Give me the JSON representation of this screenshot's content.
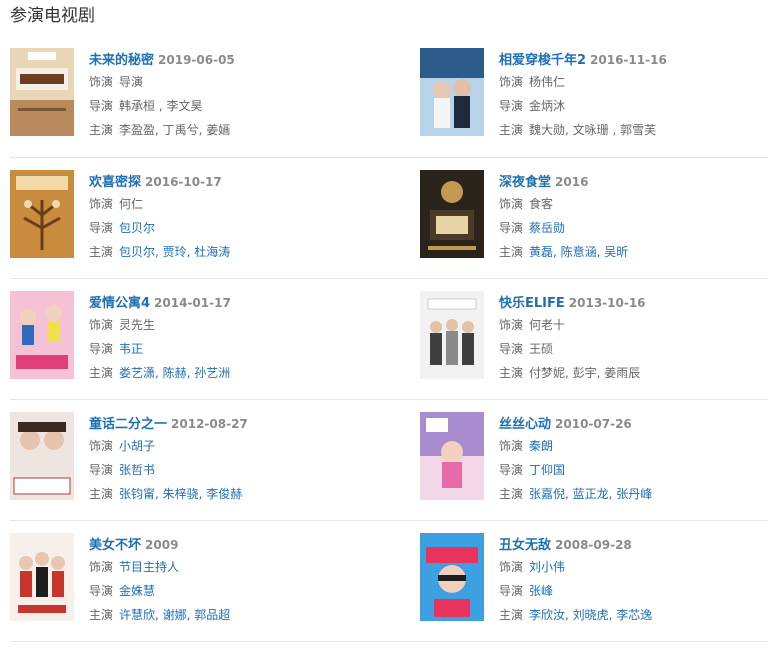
{
  "section_title": "参演电视剧",
  "labels": {
    "role": "饰演",
    "director": "导演",
    "cast": "主演"
  },
  "rows": [
    {
      "left": {
        "title": "未来的秘密",
        "date": "2019-06-05",
        "role": "导演",
        "role_link": false,
        "director": "韩承桓 , 李文昊",
        "director_link": false,
        "cast": "李盈盈, 丁禹兮, 姜婳",
        "cast_link": false,
        "poster_colors": [
          "#e9d6b7",
          "#a0714a"
        ]
      },
      "right": {
        "title": "相爱穿梭千年2",
        "date": "2016-11-16",
        "role": "杨伟仁",
        "role_link": false,
        "director": "金炳沐",
        "director_link": false,
        "cast": "魏大勋, 文咏珊 , 郭雪芙",
        "cast_link": false,
        "poster_colors": [
          "#2d5c8c",
          "#b7d3ea"
        ]
      }
    },
    {
      "left": {
        "title": "欢喜密探",
        "date": "2016-10-17",
        "role": "何仁",
        "role_link": false,
        "director": "包贝尔",
        "director_link": true,
        "cast": "包贝尔, 贾玲, 杜海涛",
        "cast_link": true,
        "poster_colors": [
          "#c98c3f",
          "#7a4a1c"
        ]
      },
      "right": {
        "title": "深夜食堂",
        "date": "2016",
        "role": "食客",
        "role_link": false,
        "director": "蔡岳勋",
        "director_link": true,
        "cast": "黄磊, 陈意涵, 吴昕",
        "cast_link": true,
        "poster_colors": [
          "#2b241c",
          "#c39a52"
        ]
      }
    },
    {
      "left": {
        "title": "爱情公寓4",
        "date": "2014-01-17",
        "role": "灵先生",
        "role_link": false,
        "director": "韦正",
        "director_link": true,
        "cast": "娄艺潇, 陈赫, 孙艺洲",
        "cast_link": true,
        "poster_colors": [
          "#f4c1d5",
          "#e0407a"
        ]
      },
      "right": {
        "title": "快乐ELIFE",
        "date": "2013-10-16",
        "role": "何老十",
        "role_link": false,
        "director": "王硕",
        "director_link": false,
        "cast": "付梦妮, 彭宇, 姜雨辰",
        "cast_link": false,
        "poster_colors": [
          "#f2f2f2",
          "#3f3f3f"
        ]
      }
    },
    {
      "left": {
        "title": "童话二分之一",
        "date": "2012-08-27",
        "role": "小胡子",
        "role_link": true,
        "director": "张哲书",
        "director_link": true,
        "cast": "张钧甯, 朱梓骁, 李俊赫",
        "cast_link": true,
        "poster_colors": [
          "#efe5e0",
          "#b23a3a"
        ]
      },
      "right": {
        "title": "丝丝心动",
        "date": "2010-07-26",
        "role": "秦朗",
        "role_link": true,
        "director": "丁仰国",
        "director_link": true,
        "cast": "张嘉倪, 蓝正龙, 张丹峰",
        "cast_link": true,
        "poster_colors": [
          "#a98bd0",
          "#f2d7e9"
        ]
      }
    },
    {
      "left": {
        "title": "美女不坏",
        "date": "2009",
        "role": "节目主持人",
        "role_link": true,
        "director": "金姝慧",
        "director_link": true,
        "cast": "许慧欣, 谢娜, 郭品超",
        "cast_link": true,
        "poster_colors": [
          "#f7f0ea",
          "#c8352f"
        ]
      },
      "right": {
        "title": "丑女无敌",
        "date": "2008-09-28",
        "role": "刘小伟",
        "role_link": true,
        "director": "张峰",
        "director_link": true,
        "cast": "李欣汝, 刘晓虎, 李芯逸",
        "cast_link": true,
        "poster_colors": [
          "#3da0e0",
          "#e8345c"
        ]
      }
    }
  ]
}
